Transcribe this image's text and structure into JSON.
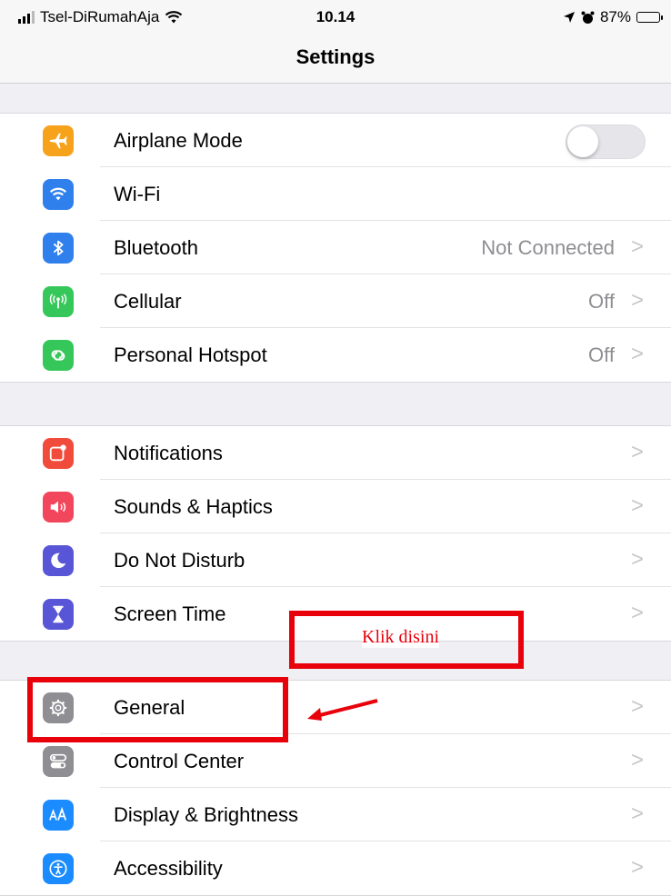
{
  "status_bar": {
    "carrier": "Tsel-DiRumahAja",
    "time": "10.14",
    "battery": "87%",
    "battery_level": 0.87
  },
  "nav": {
    "title": "Settings"
  },
  "groups": [
    {
      "rows": [
        {
          "label": "Airplane Mode",
          "icon": "airplane-icon",
          "color": "#f7a21b",
          "toggle": false
        },
        {
          "label": "Wi-Fi",
          "icon": "wifi-icon",
          "color": "#2f80ed"
        },
        {
          "label": "Bluetooth",
          "icon": "bluetooth-icon",
          "color": "#2f80ed",
          "value": "Not Connected"
        },
        {
          "label": "Cellular",
          "icon": "antenna-icon",
          "color": "#35c759",
          "value": "Off"
        },
        {
          "label": "Personal Hotspot",
          "icon": "hotspot-icon",
          "color": "#35c759",
          "value": "Off"
        }
      ]
    },
    {
      "rows": [
        {
          "label": "Notifications",
          "icon": "notifications-icon",
          "color": "#f04b3b"
        },
        {
          "label": "Sounds & Haptics",
          "icon": "speaker-icon",
          "color": "#f2465c"
        },
        {
          "label": "Do Not Disturb",
          "icon": "moon-icon",
          "color": "#5856d6"
        },
        {
          "label": "Screen Time",
          "icon": "hourglass-icon",
          "color": "#5856d6"
        }
      ]
    },
    {
      "rows": [
        {
          "label": "General",
          "icon": "gear-icon",
          "color": "#8e8e93"
        },
        {
          "label": "Control Center",
          "icon": "switches-icon",
          "color": "#8e8e93"
        },
        {
          "label": "Display & Brightness",
          "icon": "text-size-icon",
          "color": "#1a8cff"
        },
        {
          "label": "Accessibility",
          "icon": "accessibility-icon",
          "color": "#1a8cff"
        }
      ]
    }
  ],
  "chevron": ">",
  "annotation": {
    "callout_text": "Klik disini",
    "color": "#e8000b"
  }
}
